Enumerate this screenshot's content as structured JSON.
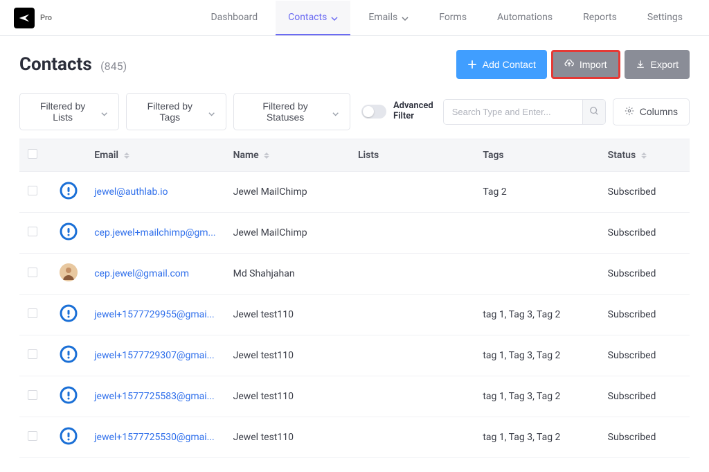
{
  "brand": {
    "pro_label": "Pro"
  },
  "nav": {
    "items": [
      {
        "label": "Dashboard",
        "has_chevron": false,
        "active": false
      },
      {
        "label": "Contacts",
        "has_chevron": true,
        "active": true
      },
      {
        "label": "Emails",
        "has_chevron": true,
        "active": false
      },
      {
        "label": "Forms",
        "has_chevron": false,
        "active": false
      },
      {
        "label": "Automations",
        "has_chevron": false,
        "active": false
      },
      {
        "label": "Reports",
        "has_chevron": false,
        "active": false
      },
      {
        "label": "Settings",
        "has_chevron": false,
        "active": false
      }
    ]
  },
  "header": {
    "title": "Contacts",
    "count": "(845)",
    "add_label": "Add Contact",
    "import_label": "Import",
    "export_label": "Export"
  },
  "filters": {
    "lists_label": "Filtered by Lists",
    "tags_label": "Filtered by Tags",
    "statuses_label": "Filtered by Statuses",
    "advanced_line1": "Advanced",
    "advanced_line2": "Filter",
    "search_placeholder": "Search Type and Enter...",
    "columns_label": "Columns"
  },
  "table": {
    "columns": {
      "email": "Email",
      "name": "Name",
      "lists": "Lists",
      "tags": "Tags",
      "status": "Status"
    },
    "rows": [
      {
        "avatar": "default",
        "email": "jewel@authlab.io",
        "name": "Jewel MailChimp",
        "lists": "",
        "tags": "Tag 2",
        "status": "Subscribed"
      },
      {
        "avatar": "default",
        "email": "cep.jewel+mailchimp@gm...",
        "name": "Jewel MailChimp",
        "lists": "",
        "tags": "",
        "status": "Subscribed"
      },
      {
        "avatar": "photo",
        "email": "cep.jewel@gmail.com",
        "name": "Md Shahjahan",
        "lists": "",
        "tags": "",
        "status": "Subscribed"
      },
      {
        "avatar": "default",
        "email": "jewel+1577729955@gmai...",
        "name": "Jewel test110",
        "lists": "",
        "tags": "tag 1, Tag 3, Tag 2",
        "status": "Subscribed"
      },
      {
        "avatar": "default",
        "email": "jewel+1577729307@gmai...",
        "name": "Jewel test110",
        "lists": "",
        "tags": "tag 1, Tag 3, Tag 2",
        "status": "Subscribed"
      },
      {
        "avatar": "default",
        "email": "jewel+1577725583@gmai...",
        "name": "Jewel test110",
        "lists": "",
        "tags": "tag 1, Tag 3, Tag 2",
        "status": "Subscribed"
      },
      {
        "avatar": "default",
        "email": "jewel+1577725530@gmai...",
        "name": "Jewel test110",
        "lists": "",
        "tags": "tag 1, Tag 3, Tag 2",
        "status": "Subscribed"
      }
    ]
  }
}
